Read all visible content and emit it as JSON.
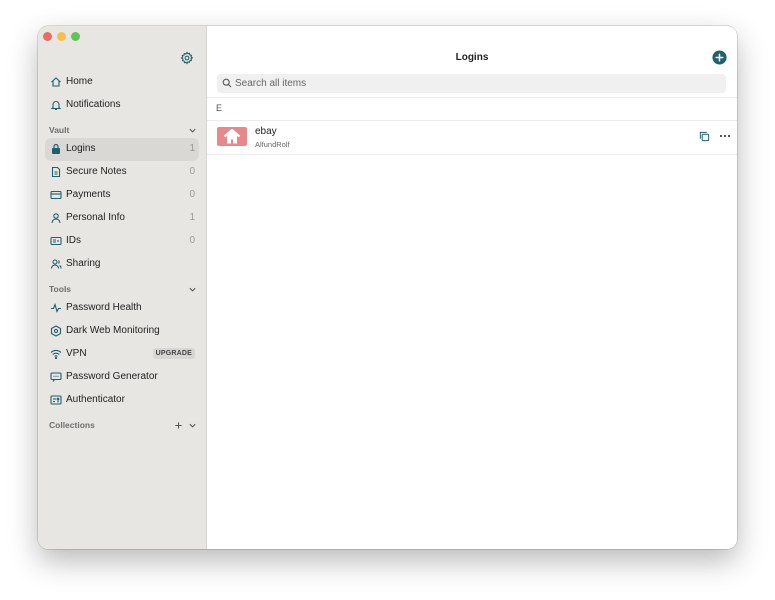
{
  "sidebar": {
    "top": [
      {
        "label": "Home",
        "icon": "home-icon"
      },
      {
        "label": "Notifications",
        "icon": "bell-icon"
      }
    ],
    "vault": {
      "header": "Vault",
      "items": [
        {
          "label": "Logins",
          "count": "1",
          "icon": "lock-icon",
          "selected": true
        },
        {
          "label": "Secure Notes",
          "count": "0",
          "icon": "note-icon"
        },
        {
          "label": "Payments",
          "count": "0",
          "icon": "credit-card-icon"
        },
        {
          "label": "Personal Info",
          "count": "1",
          "icon": "person-icon"
        },
        {
          "label": "IDs",
          "count": "0",
          "icon": "id-card-icon"
        },
        {
          "label": "Sharing",
          "icon": "sharing-icon"
        }
      ]
    },
    "tools": {
      "header": "Tools",
      "items": [
        {
          "label": "Password Health",
          "icon": "pulse-icon"
        },
        {
          "label": "Dark Web Monitoring",
          "icon": "dark-web-icon"
        },
        {
          "label": "VPN",
          "icon": "wifi-icon",
          "badge": "UPGRADE"
        },
        {
          "label": "Password Generator",
          "icon": "generator-icon"
        },
        {
          "label": "Authenticator",
          "icon": "authenticator-icon"
        }
      ]
    },
    "collections": {
      "header": "Collections"
    }
  },
  "main": {
    "title": "Logins",
    "search": {
      "placeholder": "Search all items",
      "value": ""
    },
    "groups": [
      {
        "letter": "E",
        "items": [
          {
            "name": "ebay",
            "username": "AlfundRolf",
            "thumb_icon": "house-icon"
          }
        ]
      }
    ]
  },
  "colors": {
    "accent": "#1f5f6e",
    "sidebar_bg": "#e7e6e3",
    "selected_bg": "#d9d8d5",
    "thumb_bg": "#e8888a"
  }
}
